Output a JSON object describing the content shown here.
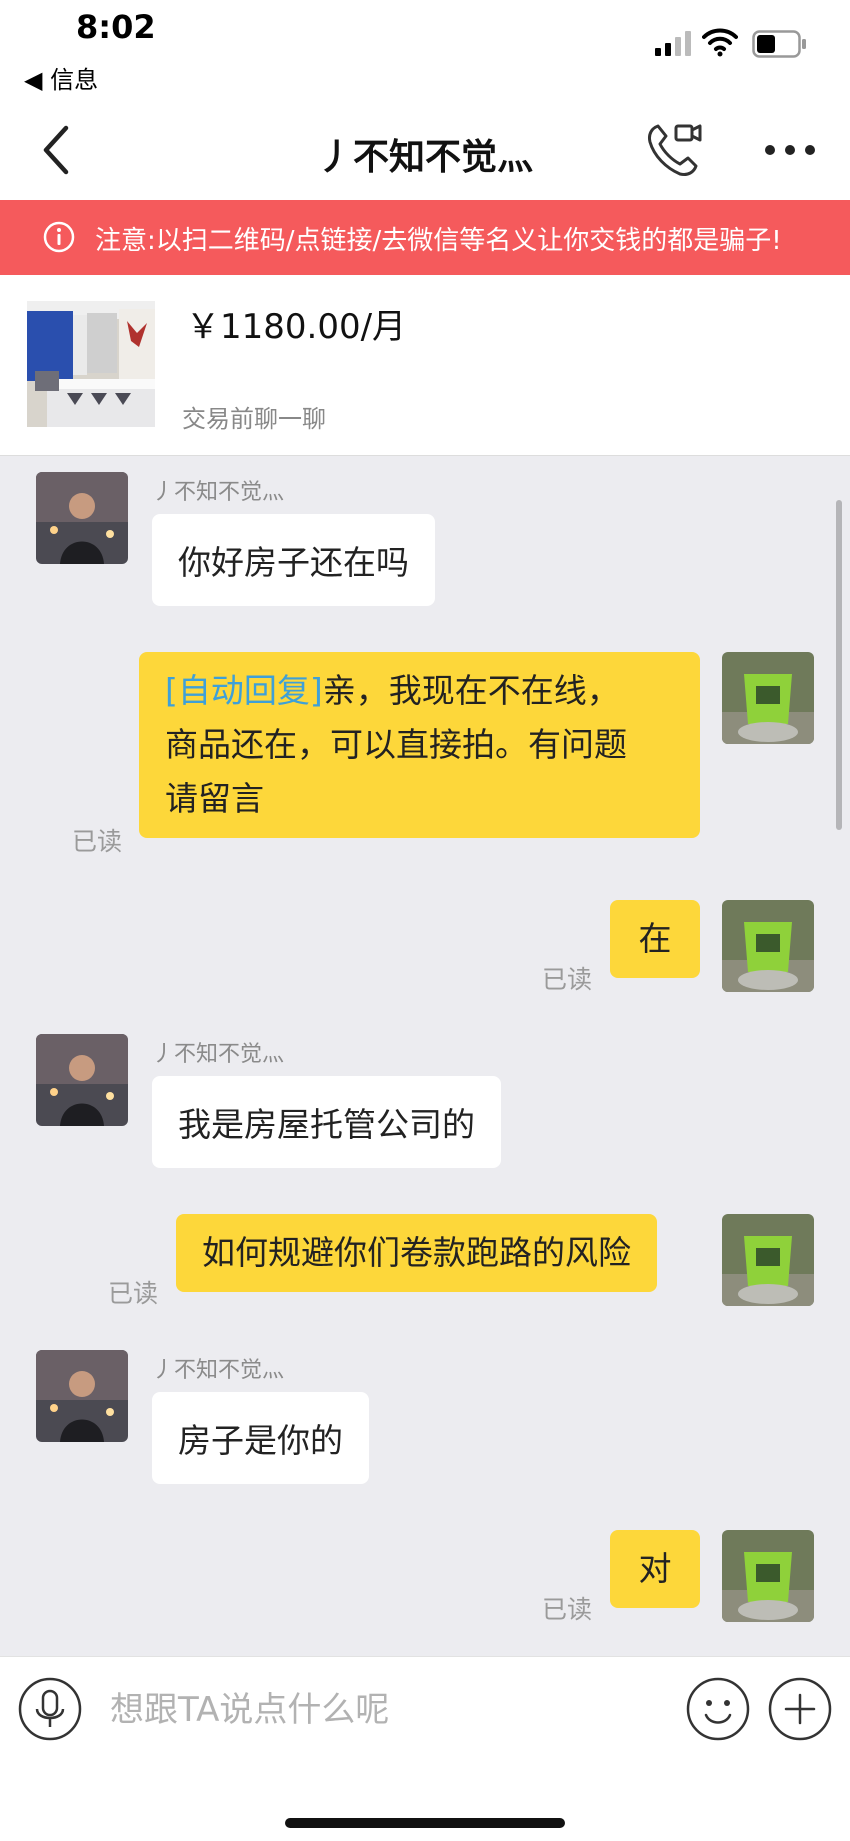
{
  "status_bar": {
    "time": "8:02",
    "back_app": "◀ 信息"
  },
  "nav": {
    "title": "丿不知不觉灬"
  },
  "warning": {
    "text": "注意:以扫二维码/点链接/去微信等名义让你交钱的都是骗子!"
  },
  "product": {
    "price": "￥1180.00/月",
    "subtitle": "交易前聊一聊"
  },
  "chat": {
    "messages": [
      {
        "from": "other",
        "sender": "丿不知不觉灬",
        "text": "你好房子还在吗"
      },
      {
        "from": "me",
        "auto_tag": "[自动回复]",
        "lines": [
          "亲，我现在不在线，",
          "商品还在，可以直接拍。有问题",
          "请留言"
        ],
        "read": "已读"
      },
      {
        "from": "me",
        "text": "在",
        "read": "已读"
      },
      {
        "from": "other",
        "sender": "丿不知不觉灬",
        "text": "我是房屋托管公司的"
      },
      {
        "from": "me",
        "text": "如何规避你们卷款跑路的风险",
        "read": "已读"
      },
      {
        "from": "other",
        "sender": "丿不知不觉灬",
        "text": "房子是你的"
      },
      {
        "from": "me",
        "text": "对",
        "read": "已读"
      }
    ]
  },
  "input": {
    "placeholder": "想跟TA说点什么呢"
  },
  "colors": {
    "warning_bg": "#f55a5c",
    "my_bubble": "#fdd73a",
    "auto_tag": "#3ea0d8"
  }
}
